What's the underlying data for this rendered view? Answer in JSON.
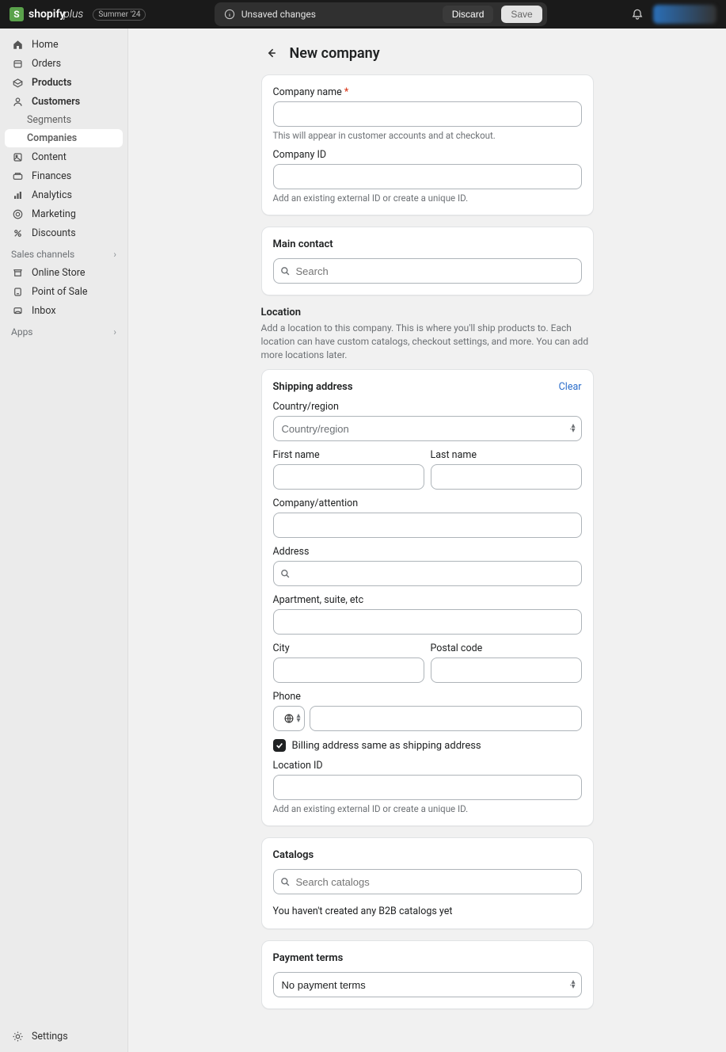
{
  "topbar": {
    "brand": "shopify",
    "brand_suffix": "plus",
    "summer_badge": "Summer '24",
    "unsaved_text": "Unsaved changes",
    "discard_label": "Discard",
    "save_label": "Save"
  },
  "sidebar": {
    "items": [
      {
        "label": "Home"
      },
      {
        "label": "Orders"
      },
      {
        "label": "Products"
      },
      {
        "label": "Customers"
      },
      {
        "label": "Segments"
      },
      {
        "label": "Companies"
      },
      {
        "label": "Content"
      },
      {
        "label": "Finances"
      },
      {
        "label": "Analytics"
      },
      {
        "label": "Marketing"
      },
      {
        "label": "Discounts"
      }
    ],
    "sales_channels_label": "Sales channels",
    "channels": [
      {
        "label": "Online Store"
      },
      {
        "label": "Point of Sale"
      },
      {
        "label": "Inbox"
      }
    ],
    "apps_label": "Apps",
    "settings_label": "Settings"
  },
  "page": {
    "title": "New company",
    "company_name_label": "Company name",
    "company_name_help": "This will appear in customer accounts and at checkout.",
    "company_id_label": "Company ID",
    "company_id_help": "Add an existing external ID or create a unique ID.",
    "main_contact_heading": "Main contact",
    "search_placeholder": "Search",
    "location_heading": "Location",
    "location_desc": "Add a location to this company. This is where you'll ship products to. Each location can have custom catalogs, checkout settings, and more. You can add more locations later.",
    "shipping_heading": "Shipping address",
    "clear_label": "Clear",
    "country_label": "Country/region",
    "country_value": "Country/region",
    "first_name_label": "First name",
    "last_name_label": "Last name",
    "company_attention_label": "Company/attention",
    "address_label": "Address",
    "apartment_label": "Apartment, suite, etc",
    "city_label": "City",
    "postal_label": "Postal code",
    "phone_label": "Phone",
    "billing_same_label": "Billing address same as shipping address",
    "location_id_label": "Location ID",
    "location_id_help": "Add an existing external ID or create a unique ID.",
    "catalogs_heading": "Catalogs",
    "catalogs_search_placeholder": "Search catalogs",
    "catalogs_empty": "You haven't created any B2B catalogs yet",
    "payment_terms_heading": "Payment terms",
    "payment_terms_value": "No payment terms"
  }
}
